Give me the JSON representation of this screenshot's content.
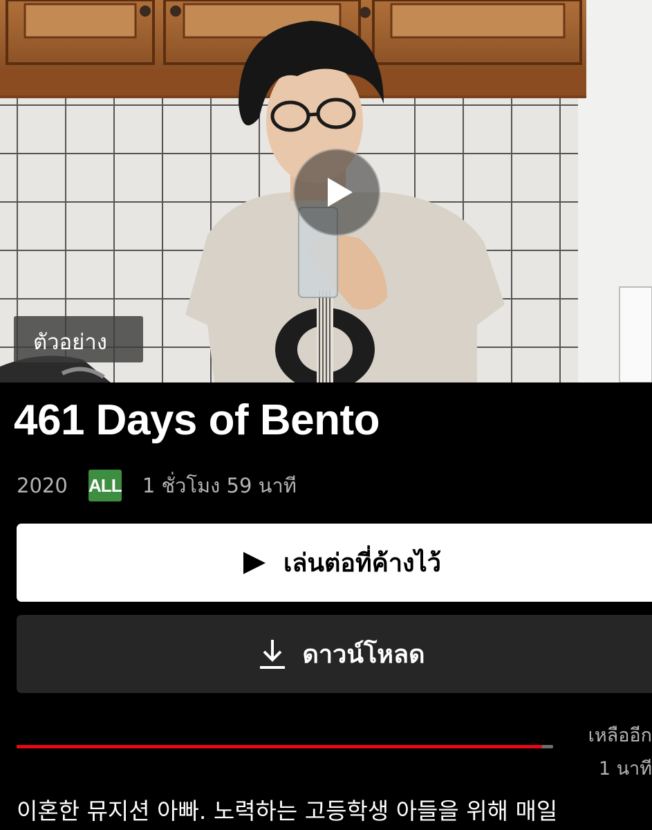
{
  "hero": {
    "preview_badge": "ตัวอย่าง",
    "play_icon": "play-circle-icon"
  },
  "title": "461 Days of Bento",
  "meta": {
    "year": "2020",
    "rating": "ALL",
    "rating_color": "#3e8e41",
    "duration": "1 ชั่วโมง 59 นาที"
  },
  "actions": {
    "resume_label": "เล่นต่อที่ค้างไว้",
    "resume_icon": "play-icon",
    "download_label": "ดาวน์โหลด",
    "download_icon": "download-icon"
  },
  "progress": {
    "watched_fraction": 0.98,
    "fill_color": "#e50914",
    "remaining_line1": "เหลืออีก",
    "remaining_line2": "1 นาที"
  },
  "description": "이혼한 뮤지션 아빠. 노력하는 고등학생 아들을 위해 매일"
}
